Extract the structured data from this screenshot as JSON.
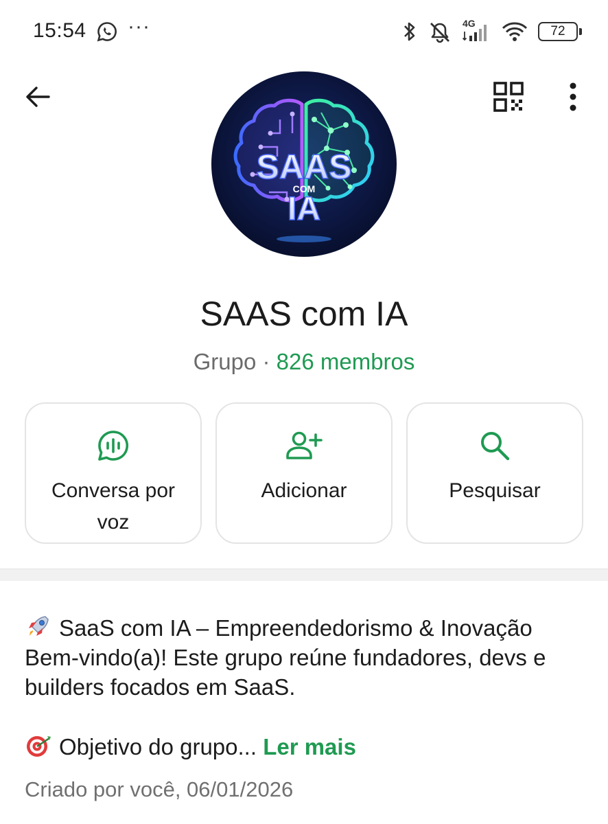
{
  "status_bar": {
    "time": "15:54",
    "more_dots": "···",
    "network_label": "4G",
    "battery_level": "72",
    "icons": [
      "whatsapp-icon",
      "bluetooth-icon",
      "muted-bell-icon",
      "cellular-signal-icon",
      "wifi-icon",
      "battery-icon"
    ]
  },
  "top_bar": {
    "icons": [
      "back-arrow-icon",
      "qr-code-icon",
      "more-vert-icon"
    ]
  },
  "avatar": {
    "logo_text_main": "SAAS",
    "logo_text_small": "COM",
    "logo_text_bottom": "IA"
  },
  "group": {
    "name": "SAAS com IA",
    "kind": "Grupo",
    "separator": "·",
    "members": "826 membros"
  },
  "actions": [
    {
      "label": "Conversa por voz",
      "icon": "voice-chat-icon"
    },
    {
      "label": "Adicionar",
      "icon": "add-person-icon"
    },
    {
      "label": "Pesquisar",
      "icon": "search-icon"
    }
  ],
  "description": {
    "line1": "SaaS com IA – Empreendedorismo & Inovação",
    "line2": "Bem-vindo(a)! Este grupo reúne fundadores, devs e",
    "line3": "builders focados em SaaS.",
    "line4": "Objetivo do grupo...",
    "read_more": "Ler mais",
    "created": "Criado por você, 06/01/2026"
  },
  "colors": {
    "accent_green": "#1f9a52",
    "text_primary": "#1c1c1c",
    "text_secondary": "#6b6b6b"
  }
}
